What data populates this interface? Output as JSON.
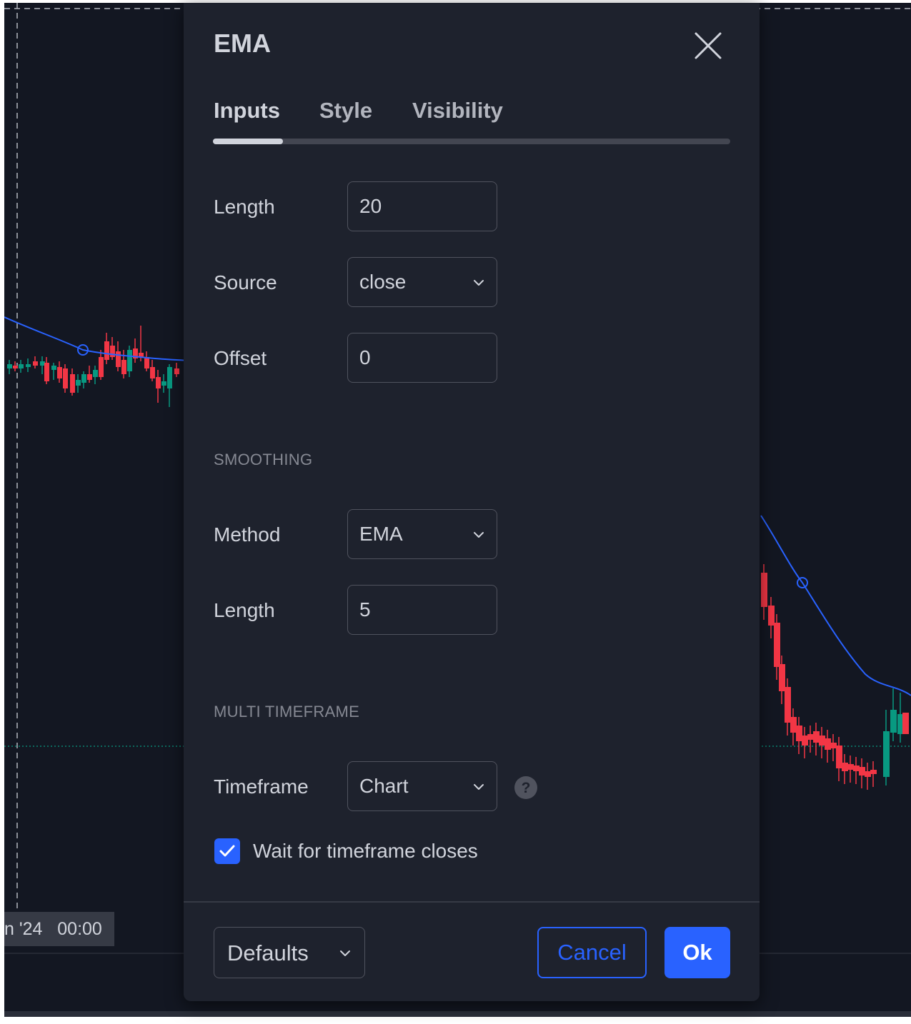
{
  "colors": {
    "chart_background": "#131722",
    "dialog_background": "#1e222d",
    "accent": "#2962ff",
    "candle_up": "#089981",
    "candle_down": "#f23645",
    "ema_line": "#2962ff",
    "text_primary": "#d1d4dc",
    "text_muted": "#868993"
  },
  "chart": {
    "time_label": "n '24   00:00"
  },
  "dialog": {
    "title": "EMA",
    "close_icon": "close-icon",
    "tabs": [
      {
        "label": "Inputs",
        "active": true
      },
      {
        "label": "Style",
        "active": false
      },
      {
        "label": "Visibility",
        "active": false
      }
    ],
    "inputs": {
      "length": {
        "label": "Length",
        "value": "20"
      },
      "source": {
        "label": "Source",
        "value": "close"
      },
      "offset": {
        "label": "Offset",
        "value": "0"
      }
    },
    "smoothing": {
      "header": "SMOOTHING",
      "method": {
        "label": "Method",
        "value": "EMA"
      },
      "length": {
        "label": "Length",
        "value": "5"
      }
    },
    "multi_timeframe": {
      "header": "MULTI TIMEFRAME",
      "timeframe": {
        "label": "Timeframe",
        "value": "Chart",
        "help_icon": "question-icon"
      },
      "wait_checkbox": {
        "label": "Wait for timeframe closes",
        "checked": true
      }
    },
    "footer": {
      "defaults_label": "Defaults",
      "cancel_label": "Cancel",
      "ok_label": "Ok"
    }
  }
}
